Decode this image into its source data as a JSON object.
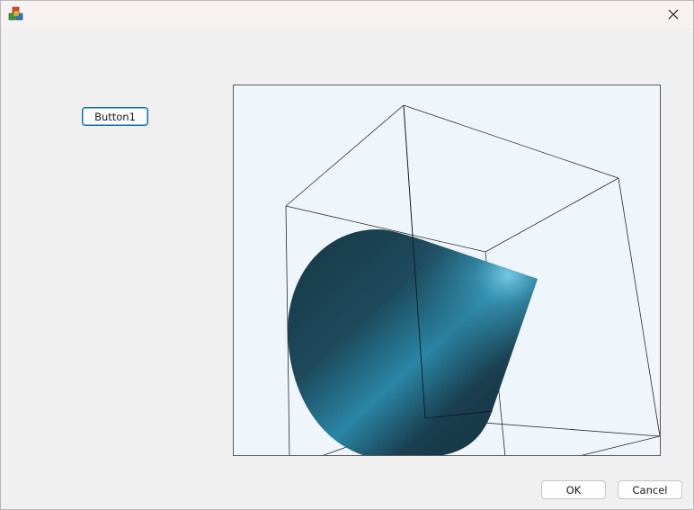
{
  "window": {
    "icon": "app-cubes-icon",
    "close_icon": "close-icon"
  },
  "buttons": {
    "button1_label": "Button1",
    "ok_label": "OK",
    "cancel_label": "Cancel"
  },
  "viewport": {
    "scene": "3D cone inside wireframe bounding box",
    "background_color": "#eef6fc",
    "cone_colors": [
      "#14303d",
      "#2a86a6"
    ],
    "wireframe_color": "#1a1a1a"
  }
}
